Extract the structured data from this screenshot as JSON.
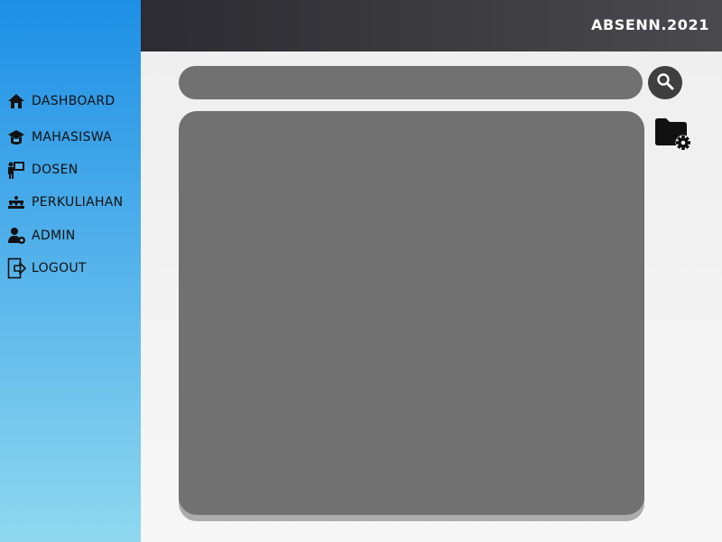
{
  "header": {
    "brand": "ABSENN.2021"
  },
  "sidebar": {
    "items": [
      {
        "label": "DASHBOARD",
        "icon": "home-icon"
      },
      {
        "label": "MAHASISWA",
        "icon": "student-icon"
      },
      {
        "label": "DOSEN",
        "icon": "lecturer-icon"
      },
      {
        "label": "PERKULIAHAN",
        "icon": "class-icon"
      },
      {
        "label": "ADMIN",
        "icon": "admin-icon"
      },
      {
        "label": "LOGOUT",
        "icon": "logout-icon"
      }
    ]
  },
  "search": {
    "placeholder": "",
    "value": ""
  },
  "icons": {
    "search": "search-icon",
    "folder_settings": "folder-settings-icon"
  },
  "colors": {
    "sidebar_top": "#1d8fe6",
    "sidebar_bottom": "#8fd8ef",
    "header_dark": "#2b2b31",
    "panel": "#717171",
    "search_button": "#3f3f3f"
  }
}
